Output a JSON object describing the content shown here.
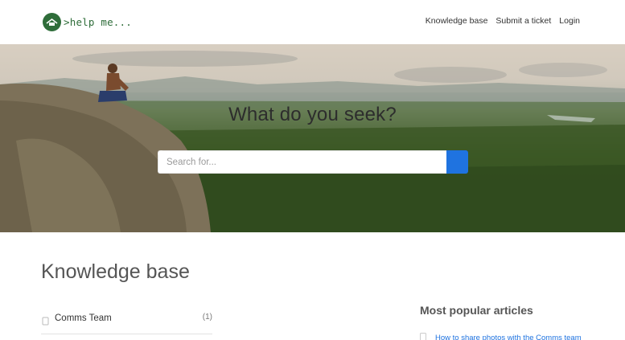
{
  "header": {
    "logo_text": ">help me...",
    "nav": [
      {
        "label": "Knowledge base"
      },
      {
        "label": "Submit a ticket"
      },
      {
        "label": "Login"
      }
    ]
  },
  "hero": {
    "title": "What do you seek?",
    "search": {
      "placeholder": "Search for...",
      "value": ""
    }
  },
  "knowledge_base": {
    "title": "Knowledge base",
    "categories": [
      {
        "label": "Comms Team",
        "count": "(1)"
      }
    ]
  },
  "popular": {
    "title": "Most popular articles",
    "articles": [
      {
        "label": "How to share photos with the Comms team"
      }
    ]
  },
  "colors": {
    "brand_green": "#2f6d3a",
    "accent_blue": "#1f73e0"
  },
  "icons": {
    "logo": "logo-badge-icon",
    "search": "search-icon",
    "category": "category-icon",
    "article": "article-icon"
  }
}
